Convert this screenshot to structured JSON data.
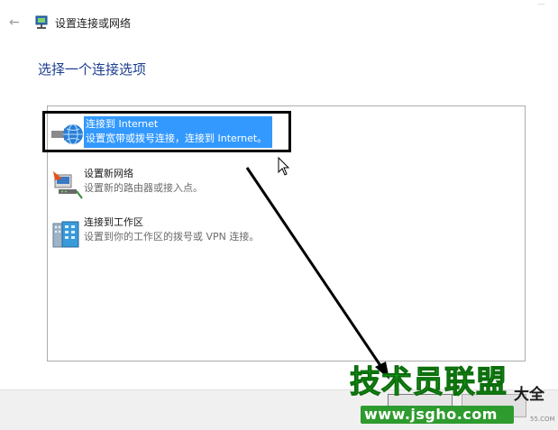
{
  "window": {
    "back_glyph": "←",
    "icon": "network-icon",
    "title": "设置连接或网络"
  },
  "heading": "选择一个连接选项",
  "options": [
    {
      "title": "连接到 Internet",
      "description": "设置宽带或拨号连接，连接到 Internet。",
      "icon": "globe-network-icon",
      "selected": true
    },
    {
      "title": "设置新网络",
      "description": "设置新的路由器或接入点。",
      "icon": "router-setup-icon",
      "selected": false
    },
    {
      "title": "连接到工作区",
      "description": "设置到你的工作区的拨号或 VPN 连接。",
      "icon": "workplace-connection-icon",
      "selected": false
    }
  ],
  "colors": {
    "heading": "#1d3f8f",
    "selection": "#3399ff",
    "annotation": "#000000",
    "watermark": "#22aa22"
  },
  "watermark": {
    "brand": "技术员联盟",
    "suffix": "大全",
    "url": "www.jsgho.com",
    "com": "55.COM"
  }
}
